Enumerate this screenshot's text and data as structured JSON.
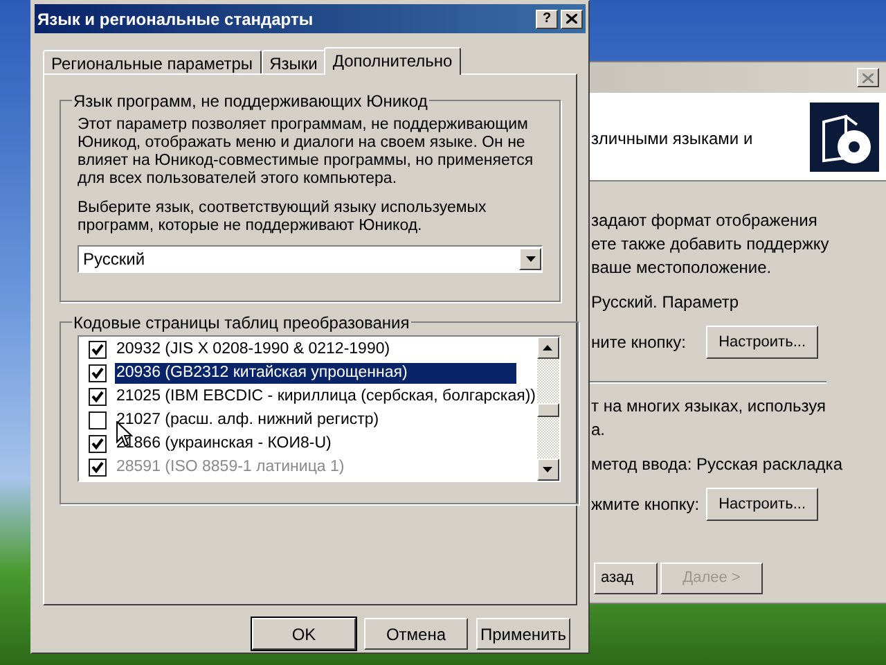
{
  "background_window": {
    "header_text": "зличными языками и",
    "lines": [
      {
        "kind": "text",
        "text": "задают формат отображения"
      },
      {
        "kind": "text",
        "text": "ете также добавить поддержку"
      },
      {
        "kind": "text",
        "text": "ваше местоположение."
      },
      {
        "kind": "gap"
      },
      {
        "kind": "text",
        "text": "Русский. Параметр"
      },
      {
        "kind": "action",
        "text": "ните кнопку:",
        "button": "Настроить..."
      },
      {
        "kind": "separator"
      },
      {
        "kind": "text",
        "text": "т на многих языках, используя"
      },
      {
        "kind": "text",
        "text": "а."
      },
      {
        "kind": "gap"
      },
      {
        "kind": "text",
        "text": "метод ввода: Русская раскладка"
      },
      {
        "kind": "action",
        "text": "жмите кнопку:",
        "button": "Настроить..."
      }
    ],
    "nav_buttons": [
      {
        "label": "азад",
        "disabled": false
      },
      {
        "label": "Далее >",
        "disabled": true
      }
    ]
  },
  "dialog": {
    "title": "Язык и региональные стандарты",
    "help_button": "?",
    "tabs": [
      {
        "label": "Региональные параметры",
        "selected": false
      },
      {
        "label": "Языки",
        "selected": false
      },
      {
        "label": "Дополнительно",
        "selected": true
      }
    ],
    "unicode_group": {
      "title": "Язык программ, не поддерживающих Юникод",
      "description": "Этот параметр позволяет программам, не поддерживающим Юникод, отображать меню и диалоги на своем языке. Он не влияет на Юникод-совместимые программы, но применяется для всех пользователей этого компьютера.",
      "hint": "Выберите язык, соответствующий языку используемых программ, которые не поддерживают Юникод.",
      "language_select": {
        "value": "Русский"
      }
    },
    "code_pages_group": {
      "title": "Кодовые страницы таблиц преобразования",
      "items": [
        {
          "label": "20932 (JIS X 0208-1990 & 0212-1990)",
          "checked": true,
          "selected": false,
          "disabled": false
        },
        {
          "label": "20936 (GB2312 китайская упрощенная)",
          "checked": true,
          "selected": true,
          "disabled": false
        },
        {
          "label": "21025 (IBM EBCDIC - кириллица (сербская, болгарская))",
          "checked": true,
          "selected": false,
          "disabled": false
        },
        {
          "label": "21027 (расш. алф. нижний регистр)",
          "checked": false,
          "selected": false,
          "disabled": false
        },
        {
          "label": "21866 (украинская - КОИ8-U)",
          "checked": true,
          "selected": false,
          "disabled": false
        },
        {
          "label": "28591 (ISO 8859-1 латиница 1)",
          "checked": true,
          "selected": false,
          "disabled": true
        }
      ]
    },
    "buttons": [
      {
        "label": "OK",
        "default": true
      },
      {
        "label": "Отмена",
        "default": false
      },
      {
        "label": "Применить",
        "default": false
      }
    ]
  }
}
